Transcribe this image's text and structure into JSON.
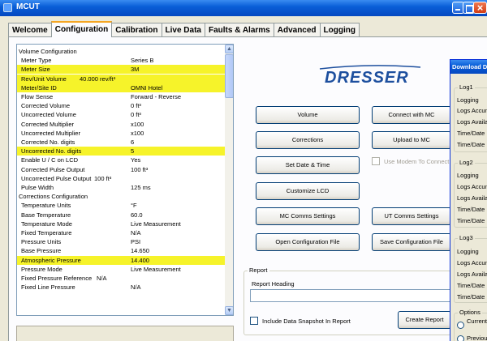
{
  "window": {
    "title": "MCUT"
  },
  "tabs": [
    "Welcome",
    "Configuration",
    "Calibration",
    "Live Data",
    "Faults & Alarms",
    "Advanced",
    "Logging"
  ],
  "active_tab": "Configuration",
  "colors": {
    "highlight": "#f6f32a",
    "titlebar": "#0a5fd8",
    "logo": "#1d4f9e"
  },
  "properties": [
    {
      "label": "Volume Configuration",
      "value": "",
      "indent": 0,
      "highlight": false
    },
    {
      "label": "Meter Type",
      "value": "Series B",
      "indent": 1,
      "highlight": false
    },
    {
      "label": "Meter Size",
      "value": "3M",
      "indent": 1,
      "highlight": true
    },
    {
      "label": "Rev/Unit Volume",
      "value": "40.000 rev/ft³",
      "indent": 1,
      "highlight": true,
      "value_offset": 77
    },
    {
      "label": "Meter/Site ID",
      "value": "OMNI Hotel",
      "indent": 1,
      "highlight": true
    },
    {
      "label": "Flow Sense",
      "value": "Forward - Reverse",
      "indent": 1,
      "highlight": false
    },
    {
      "label": "Corrected Volume",
      "value": "0 ft³",
      "indent": 1,
      "highlight": false
    },
    {
      "label": "Uncorrected Volume",
      "value": "0 ft³",
      "indent": 1,
      "highlight": false
    },
    {
      "label": "Corrected Multiplier",
      "value": "x100",
      "indent": 1,
      "highlight": false
    },
    {
      "label": "Uncorrected Multiplier",
      "value": "x100",
      "indent": 1,
      "highlight": false
    },
    {
      "label": "Corrected No. digits",
      "value": "6",
      "indent": 1,
      "highlight": false
    },
    {
      "label": "Uncorrected No. digits",
      "value": "5",
      "indent": 1,
      "highlight": true
    },
    {
      "label": "Enable U / C on LCD",
      "value": "Yes",
      "indent": 1,
      "highlight": false
    },
    {
      "label": "Corrected Pulse Output",
      "value": "100 ft³",
      "indent": 1,
      "highlight": false
    },
    {
      "label": "Uncorrected Pulse Output",
      "value": "100 ft³",
      "indent": 1,
      "highlight": false,
      "value_offset": 95
    },
    {
      "label": "Pulse Width",
      "value": "125 ms",
      "indent": 1,
      "highlight": false
    },
    {
      "label": "Corrections Configuration",
      "value": "",
      "indent": 0,
      "highlight": false
    },
    {
      "label": "Temperature Units",
      "value": "°F",
      "indent": 1,
      "highlight": false
    },
    {
      "label": "Base Temperature",
      "value": "60.0",
      "indent": 1,
      "highlight": false
    },
    {
      "label": "Temperature Mode",
      "value": "Live Measurement",
      "indent": 1,
      "highlight": false
    },
    {
      "label": "Fixed Temperature",
      "value": "N/A",
      "indent": 1,
      "highlight": false
    },
    {
      "label": "Pressure Units",
      "value": "PSI",
      "indent": 1,
      "highlight": false
    },
    {
      "label": "Base Pressure",
      "value": "14.650",
      "indent": 1,
      "highlight": false
    },
    {
      "label": "Atmospheric Pressure",
      "value": "14.400",
      "indent": 1,
      "highlight": true
    },
    {
      "label": "Pressure Mode",
      "value": "Live Measurement",
      "indent": 1,
      "highlight": false
    },
    {
      "label": "Fixed Pressure Reference",
      "value": "N/A",
      "indent": 1,
      "highlight": false,
      "value_offset": 98
    },
    {
      "label": "Fixed Line Pressure",
      "value": "N/A",
      "indent": 1,
      "highlight": false
    }
  ],
  "logo": {
    "text": "DRESSER"
  },
  "buttons": {
    "volume": "Volume",
    "corrections": "Corrections",
    "set_date_time": "Set Date & Time",
    "customize_lcd": "Customize LCD",
    "mc_comms": "MC Comms Settings",
    "open_config": "Open Configuration File",
    "connect_mc": "Connect with MC",
    "upload_mc": "Upload to MC",
    "ut_comms": "UT Comms Settings",
    "save_config": "Save Configuration File",
    "create_report": "Create Report"
  },
  "checkbox_modem": "Use Modem To Connect",
  "report": {
    "group_title": "Report",
    "heading_label": "Report Heading",
    "heading_value": "",
    "include_snapshot": "Include Data Snapshot In Report"
  },
  "download_dialog": {
    "title": "Download Data",
    "log1": {
      "title": "Log1",
      "lines": [
        "Logging",
        "Logs Accumulated",
        "Logs Available",
        "Time/Date",
        "Time/Date"
      ]
    },
    "log2": {
      "title": "Log2",
      "lines": [
        "Logging",
        "Logs Accumulated",
        "Logs Available",
        "Time/Date",
        "Time/Date"
      ]
    },
    "log3": {
      "title": "Log3",
      "lines": [
        "Logging",
        "Logs Accumulated",
        "Logs Available",
        "Time/Date",
        "Time/Date"
      ]
    },
    "options": {
      "title": "Options",
      "option1": "Current Index",
      "option2": "Previous"
    }
  }
}
